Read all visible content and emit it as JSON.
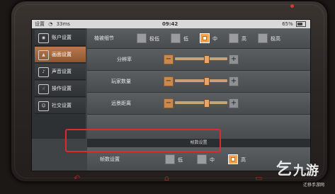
{
  "status": {
    "carrier": "设置",
    "signal": "33ms",
    "time": "09:42",
    "battery": "65%"
  },
  "sidebar": {
    "items": [
      {
        "label": "账户设置",
        "icon": "user-icon",
        "glyph": "◉",
        "active": false
      },
      {
        "label": "画面设置",
        "icon": "picture-icon",
        "glyph": "▲",
        "active": true
      },
      {
        "label": "声音设置",
        "icon": "sound-icon",
        "glyph": "♪",
        "active": false
      },
      {
        "label": "操作设置",
        "icon": "hand-icon",
        "glyph": "☝",
        "active": false
      },
      {
        "label": "社交设置",
        "icon": "social-icon",
        "glyph": "☺",
        "active": false
      }
    ]
  },
  "detail": {
    "label": "植被细节",
    "options": [
      "极低",
      "低",
      "中",
      "高",
      "极高"
    ],
    "selected": "中"
  },
  "resolution": {
    "label": "分辨率",
    "minus": "−",
    "plus": "+",
    "level": 0.6
  },
  "players": {
    "label": "玩家数量",
    "minus": "−",
    "plus": "+",
    "level": 0.6
  },
  "distance": {
    "label": "远景距离",
    "minus": "−",
    "plus": "+",
    "level": 0.6
  },
  "section": {
    "title": "帧数设置"
  },
  "framerate": {
    "label": "帧数设置",
    "options": [
      "低",
      "中",
      "高"
    ],
    "selected": "高"
  },
  "watermark": {
    "logo": "乞",
    "text": "九游",
    "sub": "迁移手游网"
  },
  "colors": {
    "accent": "#f3a24c",
    "highlight": "#e0292a",
    "active_tab": "#b87a4d"
  }
}
